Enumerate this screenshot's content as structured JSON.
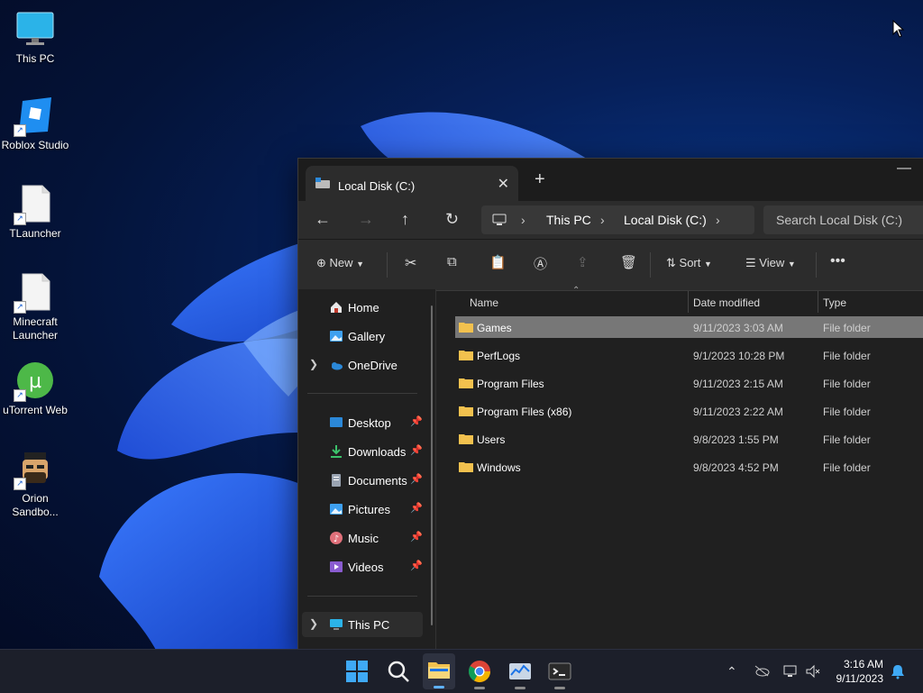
{
  "desktop": {
    "icons": [
      {
        "label": "This PC"
      },
      {
        "label": "Roblox Studio"
      },
      {
        "label": "TLauncher"
      },
      {
        "label": "Minecraft Launcher"
      },
      {
        "label": "uTorrent Web"
      },
      {
        "label": "Orion Sandbo..."
      }
    ]
  },
  "window": {
    "tab_title": "Local Disk (C:)",
    "breadcrumb": [
      "This PC",
      "Local Disk (C:)"
    ],
    "search_placeholder": "Search Local Disk (C:)",
    "toolbar": {
      "new": "New",
      "sort": "Sort",
      "view": "View"
    },
    "nav": {
      "top": [
        {
          "label": "Home"
        },
        {
          "label": "Gallery"
        },
        {
          "label": "OneDrive"
        }
      ],
      "quick": [
        {
          "label": "Desktop"
        },
        {
          "label": "Downloads"
        },
        {
          "label": "Documents"
        },
        {
          "label": "Pictures"
        },
        {
          "label": "Music"
        },
        {
          "label": "Videos"
        }
      ],
      "bottom": [
        {
          "label": "This PC"
        }
      ]
    },
    "columns": {
      "name": "Name",
      "date": "Date modified",
      "type": "Type"
    },
    "rows": [
      {
        "name": "Games",
        "date": "9/11/2023 3:03 AM",
        "type": "File folder"
      },
      {
        "name": "PerfLogs",
        "date": "9/1/2023 10:28 PM",
        "type": "File folder"
      },
      {
        "name": "Program Files",
        "date": "9/11/2023 2:15 AM",
        "type": "File folder"
      },
      {
        "name": "Program Files (x86)",
        "date": "9/11/2023 2:22 AM",
        "type": "File folder"
      },
      {
        "name": "Users",
        "date": "9/8/2023 1:55 PM",
        "type": "File folder"
      },
      {
        "name": "Windows",
        "date": "9/8/2023 4:52 PM",
        "type": "File folder"
      }
    ]
  },
  "taskbar": {
    "time": "3:16 AM",
    "date": "9/11/2023"
  },
  "colors": {
    "folder": "#f2c14e",
    "accent": "#1a73e8",
    "selection": "#777777"
  }
}
